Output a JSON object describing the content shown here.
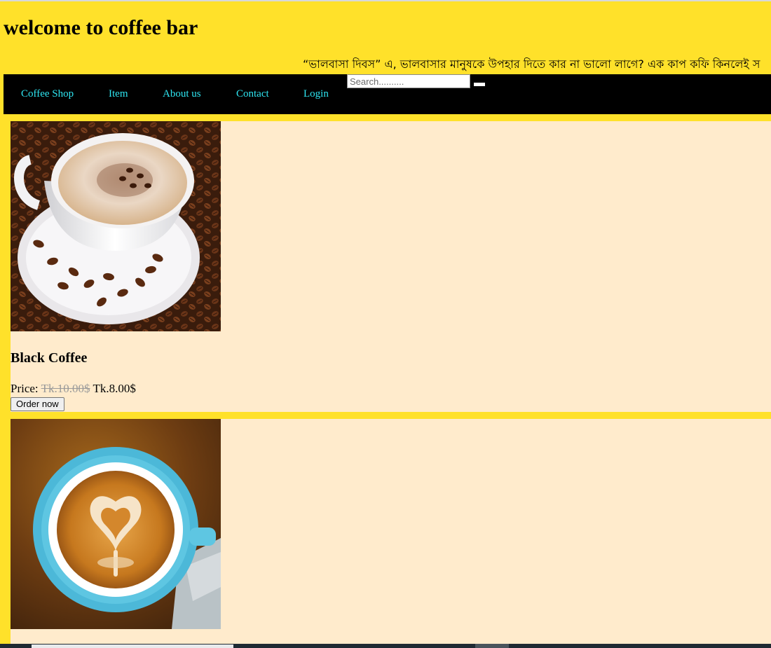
{
  "header": {
    "title": "welcome to coffee bar",
    "marquee_text": "“ভালবাসা দিবস” এ, ভালবাসার মানুষকে উপহার দিতে কার না ভালো লাগে? এক কাপ কফি কিনলেই স"
  },
  "nav": {
    "items": [
      {
        "label": "Coffee Shop"
      },
      {
        "label": "Item"
      },
      {
        "label": "About us"
      },
      {
        "label": "Contact"
      },
      {
        "label": "Login"
      }
    ],
    "search": {
      "placeholder": "Search..........",
      "value": ""
    }
  },
  "products": [
    {
      "name": "Black Coffee",
      "price_label": "Price:",
      "old_price": "Tk.10.00$",
      "new_price": "Tk.8.00$",
      "order_label": "Order now"
    },
    {
      "name": "",
      "price_label": "",
      "old_price": "",
      "new_price": "",
      "order_label": ""
    }
  ],
  "colors": {
    "page_background": "#FFE12A",
    "navbar_background": "#000000",
    "nav_link": "#2EE6F2",
    "card_background": "#FFEBCC",
    "old_price": "#9A9A9A"
  }
}
